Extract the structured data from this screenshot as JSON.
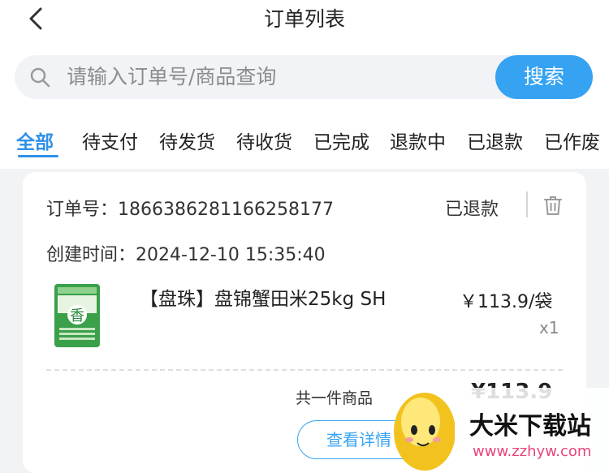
{
  "header": {
    "back_icon": "chevron-left-icon",
    "title": "订单列表"
  },
  "search": {
    "placeholder": "请输入订单号/商品查询",
    "button_label": "搜索",
    "icon": "search-icon"
  },
  "tabs": [
    {
      "label": "全部",
      "active": true
    },
    {
      "label": "待支付",
      "active": false
    },
    {
      "label": "待发货",
      "active": false
    },
    {
      "label": "待收货",
      "active": false
    },
    {
      "label": "已完成",
      "active": false
    },
    {
      "label": "退款中",
      "active": false
    },
    {
      "label": "已退款",
      "active": false
    },
    {
      "label": "已作废",
      "active": false
    }
  ],
  "order": {
    "order_no_label": "订单号：",
    "order_no": "1866386281166258177",
    "status": "已退款",
    "delete_icon": "trash-icon",
    "create_time_label": "创建时间：",
    "create_time": "2024-12-10 15:35:40",
    "product": {
      "title": "【盘珠】盘锦蟹田米25kg SH",
      "price": "￥113.9/袋",
      "quantity": "x1",
      "thumb_text": "香"
    },
    "summary": "共一件商品",
    "total": "¥113.9",
    "detail_button": "查看详情"
  },
  "watermark": {
    "text": "大米下载站",
    "url": "www.zzhyw.com"
  },
  "colors": {
    "accent": "#36a3f2",
    "active_tab": "#2f90e8",
    "background": "#f2f3f5"
  }
}
